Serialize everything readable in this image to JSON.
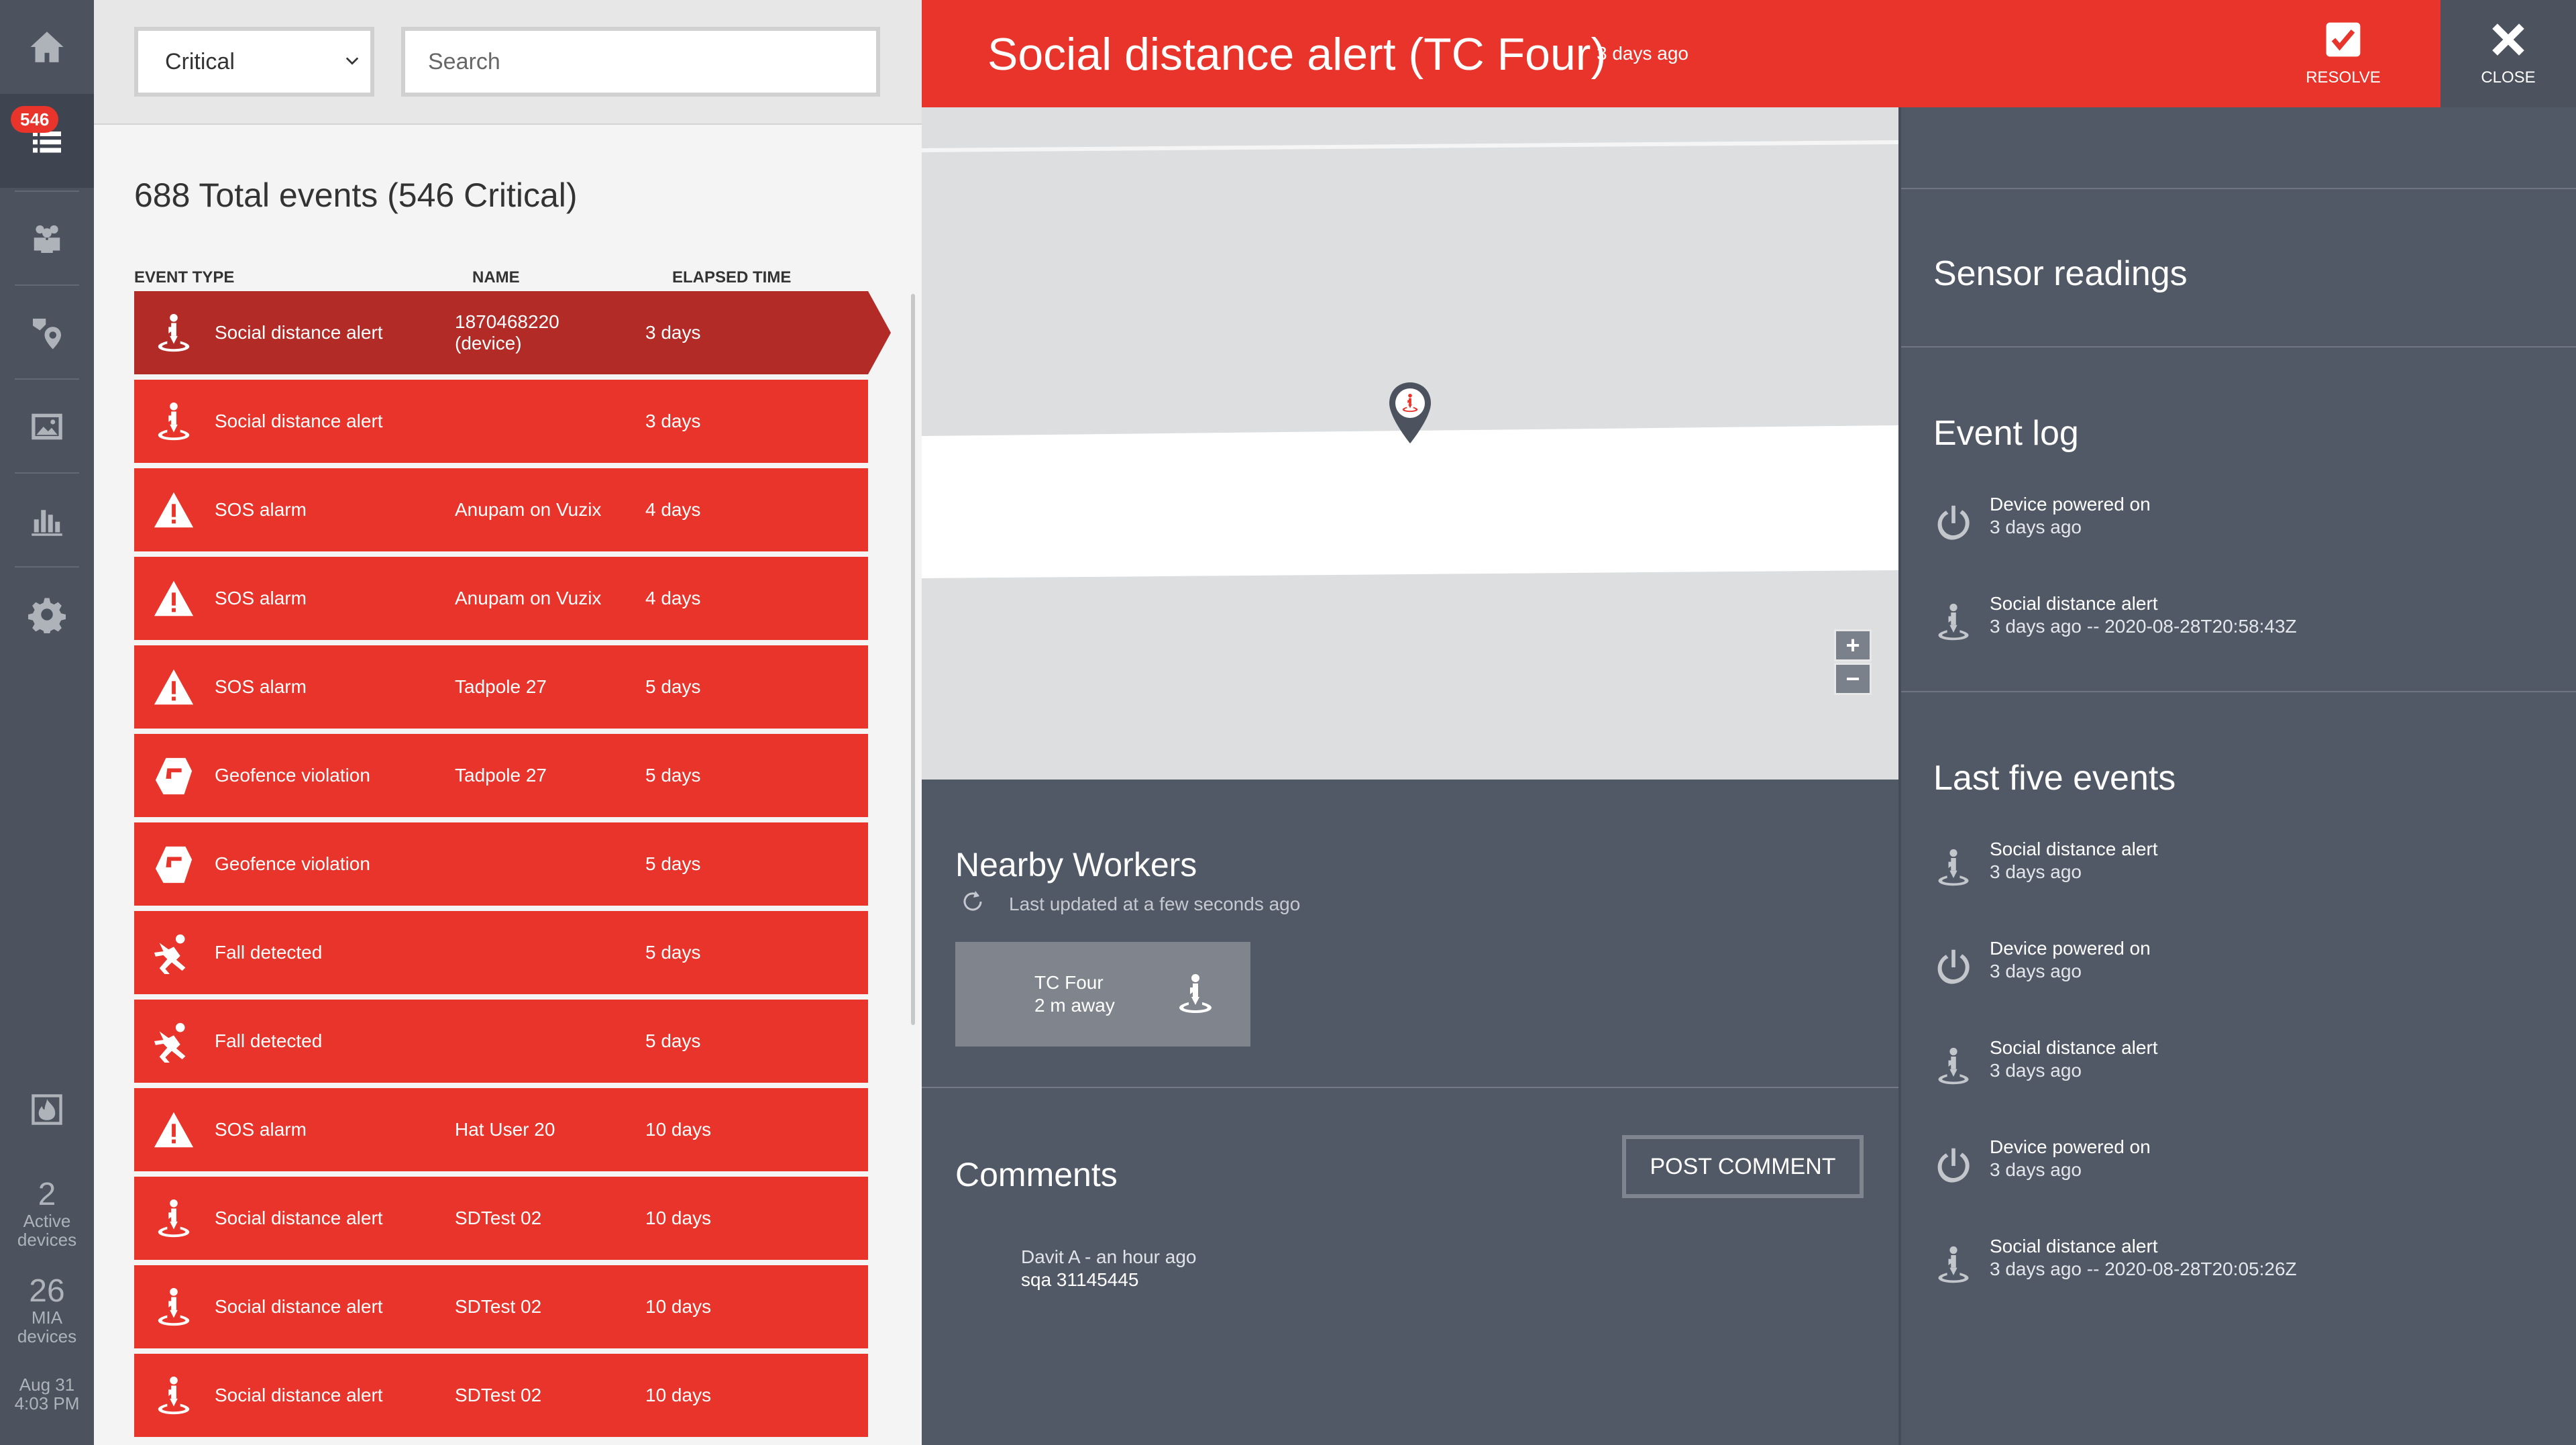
{
  "rail": {
    "badge_count": "546",
    "active_devices": {
      "count": "2",
      "label": "Active devices"
    },
    "mia_devices": {
      "count": "26",
      "label": "MIA devices"
    },
    "clock": {
      "date": "Aug 31",
      "time": "4:03 PM"
    }
  },
  "filters": {
    "severity": "Critical",
    "search_placeholder": "Search"
  },
  "events": {
    "total": "688 Total events (546 Critical)",
    "columns": {
      "type": "EVENT TYPE",
      "name": "NAME",
      "elapsed": "ELAPSED TIME"
    },
    "rows": [
      {
        "type": "Social distance alert",
        "name": "1870468220 (device)",
        "elapsed": "3 days",
        "icon": "social-distance-icon"
      },
      {
        "type": "Social distance alert",
        "name": "",
        "elapsed": "3 days",
        "icon": "social-distance-icon"
      },
      {
        "type": "SOS alarm",
        "name": "Anupam on Vuzix",
        "elapsed": "4 days",
        "icon": "warning-icon"
      },
      {
        "type": "SOS alarm",
        "name": "Anupam on Vuzix",
        "elapsed": "4 days",
        "icon": "warning-icon"
      },
      {
        "type": "SOS alarm",
        "name": "Tadpole 27",
        "elapsed": "5 days",
        "icon": "warning-icon"
      },
      {
        "type": "Geofence violation",
        "name": "Tadpole 27",
        "elapsed": "5 days",
        "icon": "geofence-icon"
      },
      {
        "type": "Geofence violation",
        "name": "",
        "elapsed": "5 days",
        "icon": "geofence-icon"
      },
      {
        "type": "Fall detected",
        "name": "",
        "elapsed": "5 days",
        "icon": "fall-icon"
      },
      {
        "type": "Fall detected",
        "name": "",
        "elapsed": "5 days",
        "icon": "fall-icon"
      },
      {
        "type": "SOS alarm",
        "name": "Hat User 20",
        "elapsed": "10 days",
        "icon": "warning-icon"
      },
      {
        "type": "Social distance alert",
        "name": "SDTest 02",
        "elapsed": "10 days",
        "icon": "social-distance-icon"
      },
      {
        "type": "Social distance alert",
        "name": "SDTest 02",
        "elapsed": "10 days",
        "icon": "social-distance-icon"
      },
      {
        "type": "Social distance alert",
        "name": "SDTest 02",
        "elapsed": "10 days",
        "icon": "social-distance-icon"
      }
    ]
  },
  "header": {
    "title": "Social distance alert (TC Four)",
    "time": "3 days ago",
    "resolve_label": "RESOLVE",
    "close_label": "CLOSE"
  },
  "map": {
    "zoom_in": "+",
    "zoom_out": "−"
  },
  "nearby": {
    "title": "Nearby Workers",
    "updated": "Last updated at a few seconds ago",
    "worker": {
      "name": "TC Four",
      "distance": "2 m away"
    }
  },
  "comments": {
    "title": "Comments",
    "post_label": "POST COMMENT",
    "items": [
      {
        "author": "Davit A - an hour ago",
        "text": "sqa 31145445"
      }
    ]
  },
  "right": {
    "sensor_title": "Sensor readings",
    "event_log_title": "Event log",
    "event_log": [
      {
        "title": "Device powered on",
        "time": "3 days ago",
        "icon": "power-icon"
      },
      {
        "title": "Social distance alert",
        "time": "3 days ago -- 2020-08-28T20:58:43Z",
        "icon": "social-distance-icon"
      }
    ],
    "last_five_title": "Last five events",
    "last_five": [
      {
        "title": "Social distance alert",
        "time": "3 days ago",
        "icon": "social-distance-icon"
      },
      {
        "title": "Device powered on",
        "time": "3 days ago",
        "icon": "power-icon"
      },
      {
        "title": "Social distance alert",
        "time": "3 days ago",
        "icon": "social-distance-icon"
      },
      {
        "title": "Device powered on",
        "time": "3 days ago",
        "icon": "power-icon"
      },
      {
        "title": "Social distance alert",
        "time": "3 days ago -- 2020-08-28T20:05:26Z",
        "icon": "social-distance-icon"
      }
    ]
  },
  "colors": {
    "alert_red": "#e8342a",
    "selected_red": "#b22b27",
    "panel_slate": "#525966",
    "rail": "#4c535e"
  }
}
